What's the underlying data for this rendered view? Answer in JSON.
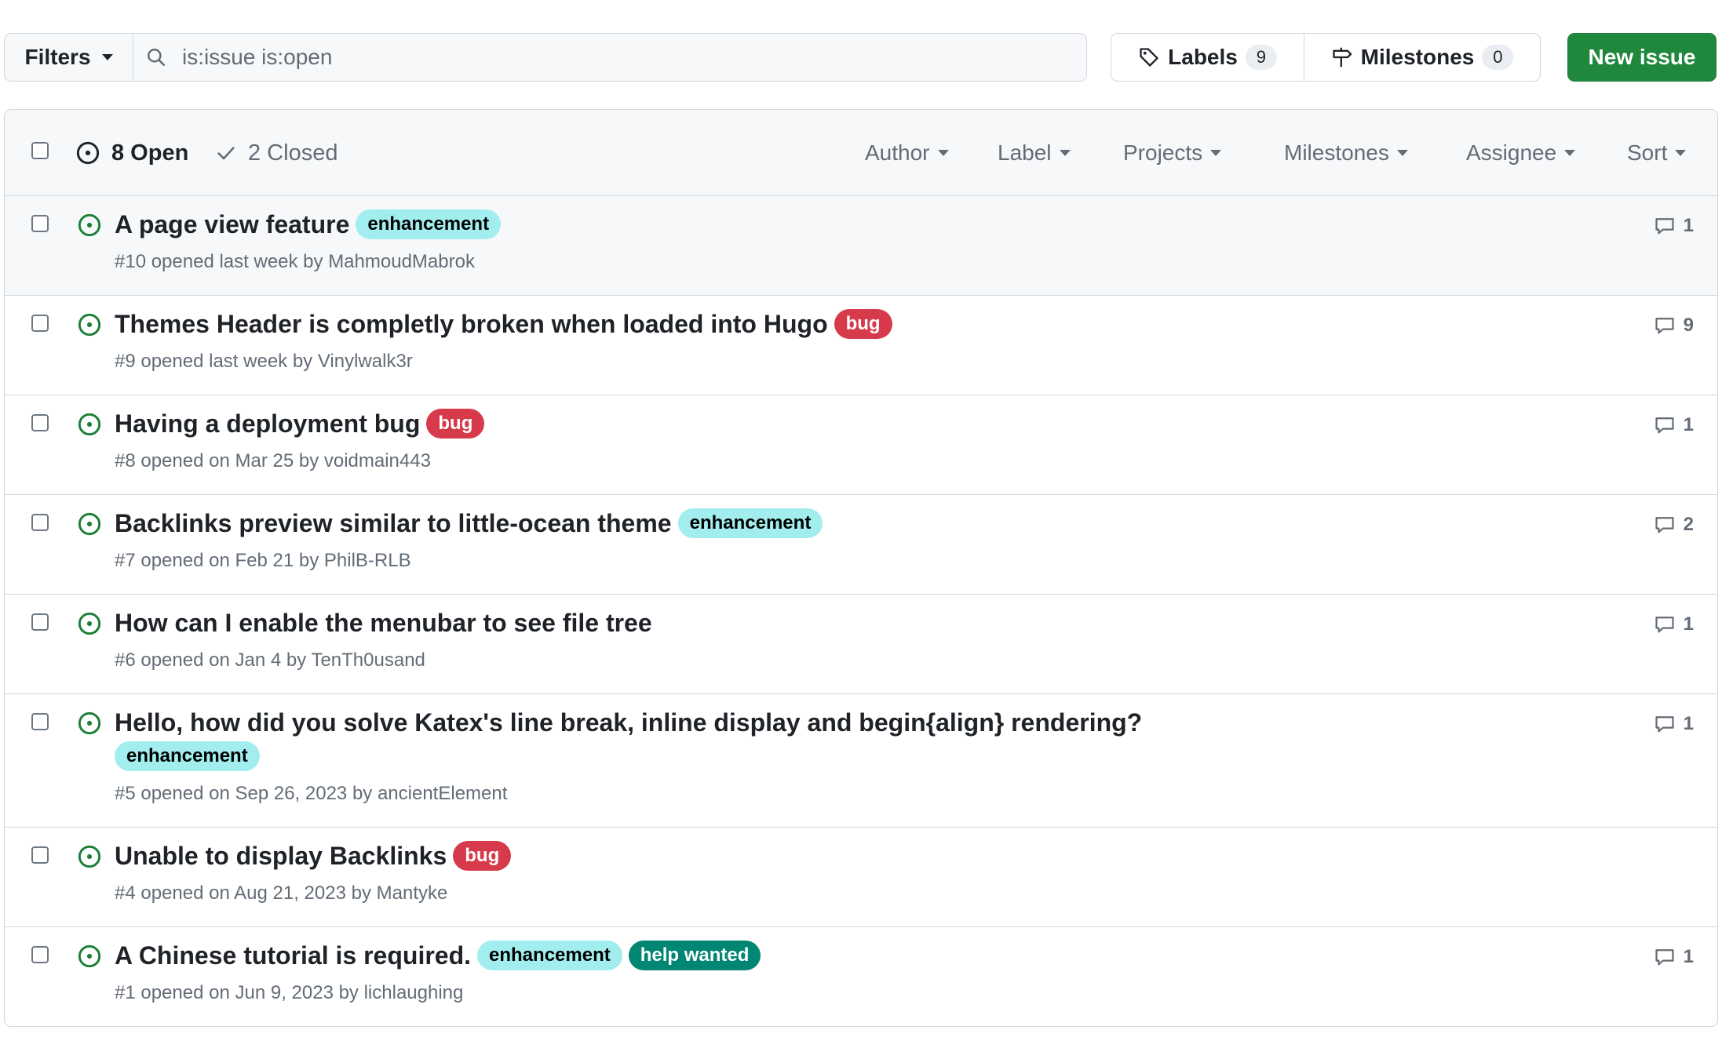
{
  "toolbar": {
    "filters_label": "Filters",
    "search_value": "is:issue is:open",
    "labels_label": "Labels",
    "labels_count": "9",
    "milestones_label": "Milestones",
    "milestones_count": "0",
    "new_issue_label": "New issue"
  },
  "header": {
    "open_label": "8 Open",
    "closed_label": "2 Closed",
    "filters": [
      "Author",
      "Label",
      "Projects",
      "Milestones",
      "Assignee",
      "Sort"
    ]
  },
  "colors": {
    "open_green": "#1a7f37",
    "enhancement_bg": "#a2eeef",
    "bug_bg": "#d73a4a",
    "help_wanted_bg": "#008672"
  },
  "issues": [
    {
      "title": "A page view feature",
      "labels": [
        "enhancement"
      ],
      "meta": "#10 opened last week by MahmoudMabrok",
      "comments": "1"
    },
    {
      "title": "Themes Header is completly broken when loaded into Hugo",
      "labels": [
        "bug"
      ],
      "meta": "#9 opened last week by Vinylwalk3r",
      "comments": "9"
    },
    {
      "title": "Having a deployment bug",
      "labels": [
        "bug"
      ],
      "meta": "#8 opened on Mar 25 by voidmain443",
      "comments": "1"
    },
    {
      "title": "Backlinks preview similar to little-ocean theme",
      "labels": [
        "enhancement"
      ],
      "meta": "#7 opened on Feb 21 by PhilB-RLB",
      "comments": "2"
    },
    {
      "title": "How can I enable the menubar to see file tree",
      "labels": [],
      "meta": "#6 opened on Jan 4 by TenTh0usand",
      "comments": "1"
    },
    {
      "title": "Hello, how did you solve Katex's line break, inline display and begin{align} rendering?",
      "labels": [
        "enhancement"
      ],
      "meta": "#5 opened on Sep 26, 2023 by ancientElement",
      "comments": "1"
    },
    {
      "title": "Unable to display Backlinks",
      "labels": [
        "bug"
      ],
      "meta": "#4 opened on Aug 21, 2023 by Mantyke",
      "comments": ""
    },
    {
      "title": "A Chinese tutorial is required.",
      "labels": [
        "enhancement",
        "help wanted"
      ],
      "meta": "#1 opened on Jun 9, 2023 by lichlaughing",
      "comments": "1"
    }
  ]
}
